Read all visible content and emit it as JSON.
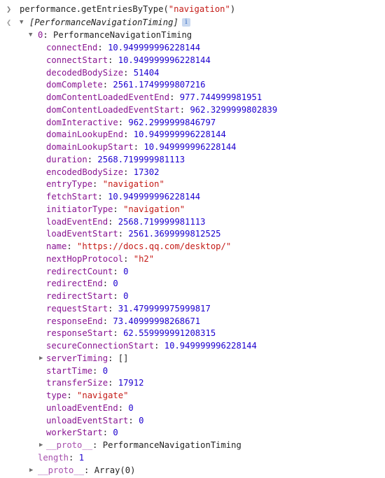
{
  "console": {
    "command": {
      "prefix": "performance.getEntriesByType(",
      "arg": "\"navigation\"",
      "suffix": ")"
    },
    "result": {
      "summary": "[PerformanceNavigationTiming]",
      "info_badge": "i",
      "entry_index": "0",
      "entry_type_name": "PerformanceNavigationTiming",
      "properties": [
        {
          "key": "connectEnd",
          "value": "10.949999996228144",
          "type": "num"
        },
        {
          "key": "connectStart",
          "value": "10.949999996228144",
          "type": "num"
        },
        {
          "key": "decodedBodySize",
          "value": "51404",
          "type": "num"
        },
        {
          "key": "domComplete",
          "value": "2561.1749999807216",
          "type": "num"
        },
        {
          "key": "domContentLoadedEventEnd",
          "value": "977.744999981951",
          "type": "num"
        },
        {
          "key": "domContentLoadedEventStart",
          "value": "962.3299999802839",
          "type": "num"
        },
        {
          "key": "domInteractive",
          "value": "962.2999999846797",
          "type": "num"
        },
        {
          "key": "domainLookupEnd",
          "value": "10.949999996228144",
          "type": "num"
        },
        {
          "key": "domainLookupStart",
          "value": "10.949999996228144",
          "type": "num"
        },
        {
          "key": "duration",
          "value": "2568.719999981113",
          "type": "num"
        },
        {
          "key": "encodedBodySize",
          "value": "17302",
          "type": "num"
        },
        {
          "key": "entryType",
          "value": "\"navigation\"",
          "type": "str"
        },
        {
          "key": "fetchStart",
          "value": "10.949999996228144",
          "type": "num"
        },
        {
          "key": "initiatorType",
          "value": "\"navigation\"",
          "type": "str"
        },
        {
          "key": "loadEventEnd",
          "value": "2568.719999981113",
          "type": "num"
        },
        {
          "key": "loadEventStart",
          "value": "2561.3699999812525",
          "type": "num"
        },
        {
          "key": "name",
          "value": "\"https://docs.qq.com/desktop/\"",
          "type": "str"
        },
        {
          "key": "nextHopProtocol",
          "value": "\"h2\"",
          "type": "str"
        },
        {
          "key": "redirectCount",
          "value": "0",
          "type": "num"
        },
        {
          "key": "redirectEnd",
          "value": "0",
          "type": "num"
        },
        {
          "key": "redirectStart",
          "value": "0",
          "type": "num"
        },
        {
          "key": "requestStart",
          "value": "31.479999975999817",
          "type": "num"
        },
        {
          "key": "responseEnd",
          "value": "73.40999998268671",
          "type": "num"
        },
        {
          "key": "responseStart",
          "value": "62.559999991208315",
          "type": "num"
        },
        {
          "key": "secureConnectionStart",
          "value": "10.949999996228144",
          "type": "num"
        },
        {
          "key": "serverTiming",
          "value": "[]",
          "type": "plain",
          "expandable": true
        },
        {
          "key": "startTime",
          "value": "0",
          "type": "num"
        },
        {
          "key": "transferSize",
          "value": "17912",
          "type": "num"
        },
        {
          "key": "type",
          "value": "\"navigate\"",
          "type": "str"
        },
        {
          "key": "unloadEventEnd",
          "value": "0",
          "type": "num"
        },
        {
          "key": "unloadEventStart",
          "value": "0",
          "type": "num"
        },
        {
          "key": "workerStart",
          "value": "0",
          "type": "num"
        }
      ],
      "entry_proto_key": "__proto__",
      "entry_proto_value": "PerformanceNavigationTiming",
      "length_key": "length",
      "length_value": "1",
      "array_proto_key": "__proto__",
      "array_proto_value": "Array(0)"
    },
    "colors": {
      "string": "#c41a16",
      "number": "#1c00cf",
      "property_key": "#881391",
      "text": "#222222",
      "chevron": "#7f7f7f"
    },
    "icons": {
      "input_prompt": "chevron-right-icon",
      "output_prompt": "chevron-left-icon",
      "expanded": "triangle-down-icon",
      "collapsed": "triangle-right-icon"
    }
  }
}
